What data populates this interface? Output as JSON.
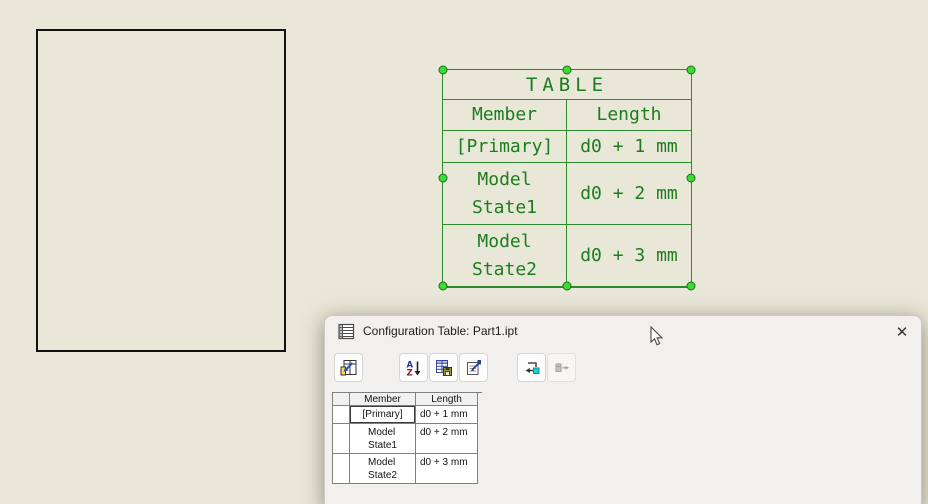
{
  "colors": {
    "canvas_bg": "#e9e7d8",
    "sketch_line": "#111111",
    "table_green_line": "#2d8a2d",
    "table_green_text": "#1d7c1e",
    "handle_fill": "#3ddc35",
    "handle_stroke": "#1c6e1c",
    "dialog_bg": "#f1f0ee",
    "insert_accent_cyan": "#18cfd6"
  },
  "drawing_table": {
    "title": "TABLE",
    "headers": [
      "Member",
      "Length"
    ],
    "rows": [
      {
        "member": "[Primary]",
        "length": "d0 + 1 mm"
      },
      {
        "member": "Model\nState1",
        "length": "d0 + 2 mm"
      },
      {
        "member": "Model\nState2",
        "length": "d0 + 3 mm"
      }
    ]
  },
  "dialog": {
    "title": "Configuration Table: Part1.ipt",
    "close_glyph": "✕",
    "toolbar": {
      "sort_letters": [
        "A",
        "Z"
      ],
      "buttons": [
        {
          "label": "model-state-table",
          "enabled": true
        },
        {
          "label": "sort-az",
          "enabled": true
        },
        {
          "label": "save-table",
          "enabled": true
        },
        {
          "label": "cell-properties",
          "enabled": true
        },
        {
          "label": "insert-member-column",
          "enabled": true
        },
        {
          "label": "export-column",
          "enabled": false
        }
      ]
    },
    "table": {
      "headers": [
        "",
        "Member",
        "Length"
      ],
      "rows": [
        {
          "member": "[Primary]",
          "length": "d0 + 1 mm",
          "focused": true
        },
        {
          "member": "Model\nState1",
          "length": "d0 + 2 mm",
          "focused": false
        },
        {
          "member": "Model\nState2",
          "length": "d0 + 3 mm",
          "focused": false
        }
      ]
    }
  }
}
